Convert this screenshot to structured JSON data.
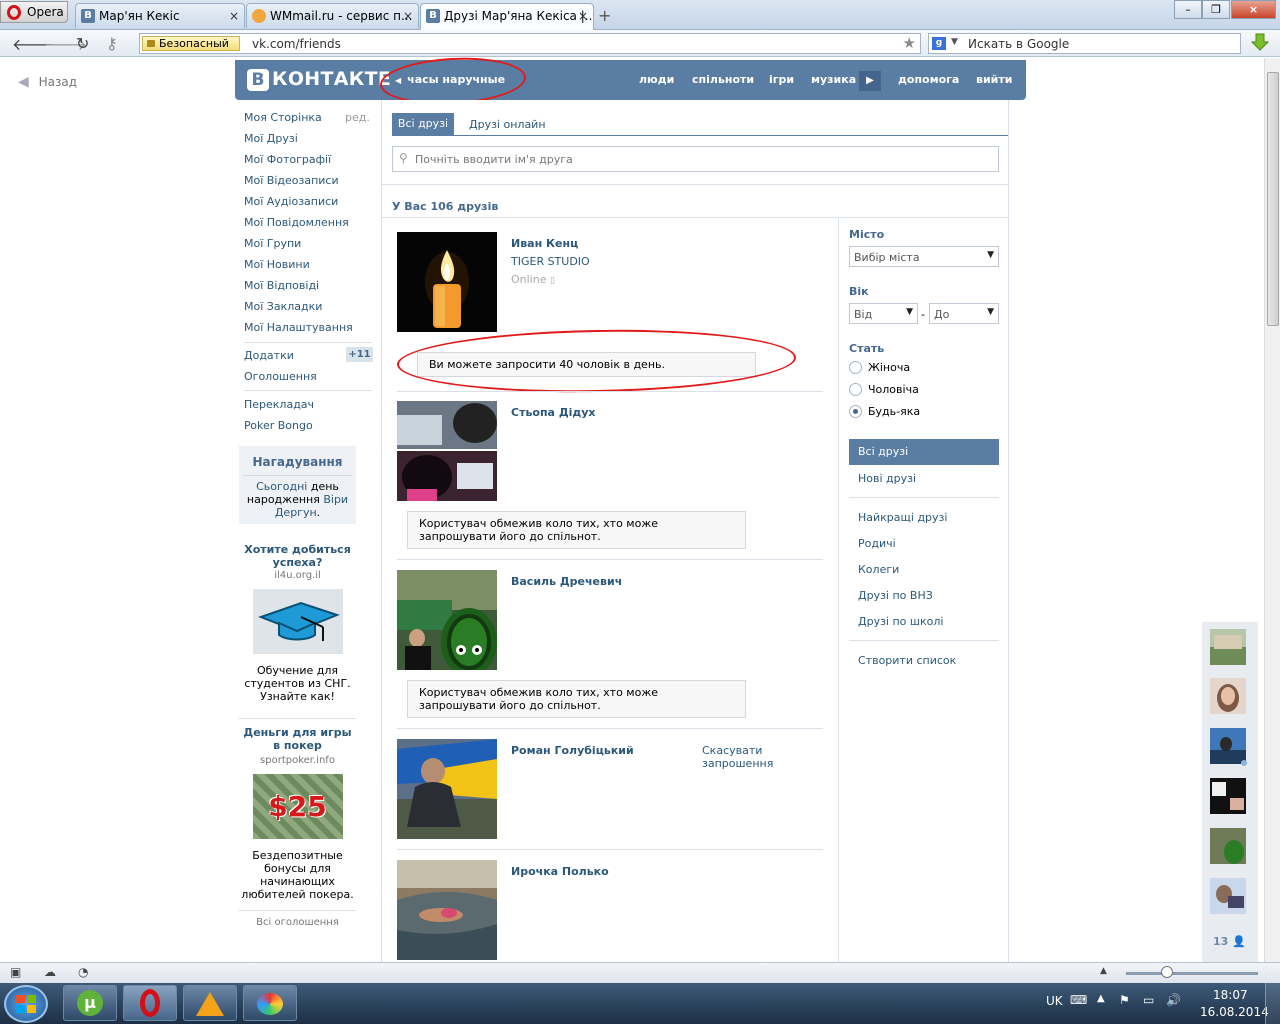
{
  "browser": {
    "opera_label": "Opera",
    "tabs": [
      {
        "title": "Мар'ян Кекіс",
        "icon": "vk-favicon",
        "favicon_text": "B"
      },
      {
        "title": "WMmail.ru - сервис п...",
        "icon": "wmmail-favicon",
        "favicon_text": ""
      },
      {
        "title": "Друзі Мар'яна Кекіса |...",
        "icon": "vk-favicon",
        "favicon_text": "B"
      }
    ],
    "close_glyph": "×",
    "new_tab_glyph": "+",
    "security_label": "Безопасный",
    "url": "vk.com/friends",
    "search_placeholder": "Искать в Google",
    "window_buttons": [
      "–",
      "❐",
      "×"
    ]
  },
  "page": {
    "back_label": "Назад",
    "logo_letter": "В",
    "logo_text": "КОНТАКТЕ",
    "status_text": "часы наручные",
    "topnav": [
      "люди",
      "спільноти",
      "ігри",
      "музика",
      "допомога",
      "вийти"
    ],
    "left_menu": [
      "Моя Сторінка",
      "Мої Друзі",
      "Мої Фотографії",
      "Мої Відеозаписи",
      "Мої Аудіозаписи",
      "Мої Повідомлення",
      "Мої Групи",
      "Мої Новини",
      "Мої Відповіді",
      "Мої Закладки",
      "Мої Налаштування"
    ],
    "edit_label": "ред.",
    "apps_label": "Додатки",
    "apps_badge": "+11",
    "ads_label": "Оголошення",
    "translator_label": "Перекладач",
    "poker_bongo_label": "Poker Bongo",
    "reminder": {
      "title": "Нагадування",
      "p1": "Сьогодні",
      "p2": " день",
      "p3": "народження ",
      "p4": "Віри",
      "p5": "Дергун",
      "p6": "."
    },
    "ad1": {
      "title": "Хотите добиться успеха?",
      "domain": "il4u.org.il",
      "text": "Обучение для студентов из СНГ. Узнайте как!"
    },
    "ad2": {
      "title": "Деньги для игры в покер",
      "domain": "sportpoker.info",
      "image_text": "$25",
      "text": "Бездепозитные бонусы для начинающих любителей покера."
    },
    "all_ads": "Всі оголошення",
    "tabs": {
      "all": "Всі друзі",
      "online": "Друзі онлайн"
    },
    "search_placeholder": "Почніть вводити ім'я друга",
    "friends_count": "У Вас 106 друзів",
    "friends": [
      {
        "name": "Иван Кенц",
        "sub": "TIGER STUDIO",
        "online": "Online",
        "note": "Ви можете запросити 40 чоловік в день."
      },
      {
        "name": "Стьопа Дідух",
        "note": "Користувач обмежив коло тих, хто може запрошувати його до спільнот."
      },
      {
        "name": "Василь Дречевич",
        "note": "Користувач обмежив коло тих, хто може запрошувати його до спільнот."
      },
      {
        "name": "Роман Голубіцький",
        "action": "Скасувати запрошення"
      },
      {
        "name": "Ирочка Полько"
      }
    ],
    "filters": {
      "city_label": "Місто",
      "city_placeholder": "Вибір міста",
      "age_label": "Вік",
      "age_from": "Від",
      "age_dash": "-",
      "age_to": "До",
      "sex_label": "Стать",
      "sex_options": [
        "Жіноча",
        "Чоловіча",
        "Будь-яка"
      ],
      "sex_selected": "Будь-яка"
    },
    "right_menu": {
      "all": "Всі друзі",
      "new": "Нові друзі",
      "lists": [
        "Найкращі друзі",
        "Родичі",
        "Колеги",
        "Друзі по ВНЗ",
        "Друзі по школі"
      ],
      "create": "Створити список"
    },
    "chat_count": "13"
  },
  "taskbar": {
    "lang": "UK",
    "time": "18:07",
    "date": "16.08.2014"
  },
  "colors": {
    "vk_blue": "#597da3",
    "link": "#2b587a",
    "annotation_red": "#e21a1a"
  }
}
